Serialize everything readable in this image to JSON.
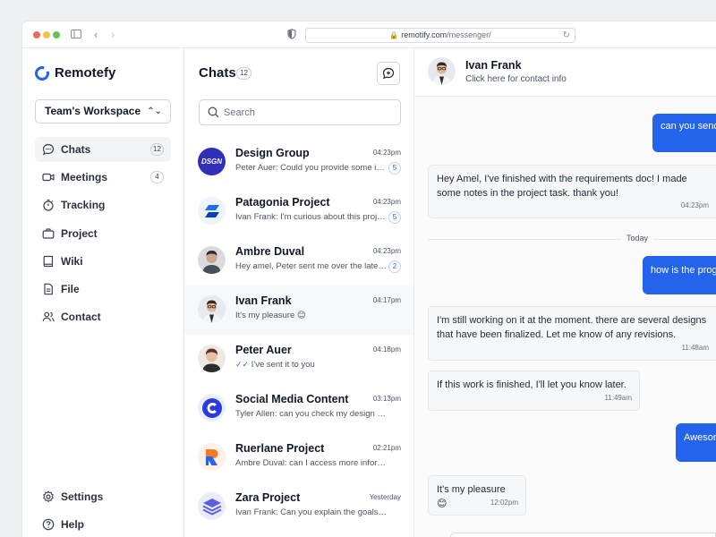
{
  "browser": {
    "url_host": "remotify.com",
    "url_path": "/messenger/"
  },
  "sidebar": {
    "brand": "Remotefy",
    "workspace": "Team's Workspace",
    "items": [
      {
        "label": "Chats",
        "icon": "chat-bubble-icon",
        "badge": "12",
        "active": true
      },
      {
        "label": "Meetings",
        "icon": "video-camera-icon",
        "badge": "4"
      },
      {
        "label": "Tracking",
        "icon": "stopwatch-icon"
      },
      {
        "label": "Project",
        "icon": "briefcase-icon"
      },
      {
        "label": "Wiki",
        "icon": "book-icon"
      },
      {
        "label": "File",
        "icon": "document-icon"
      },
      {
        "label": "Contact",
        "icon": "users-icon"
      }
    ],
    "bottom_items": [
      {
        "label": "Settings",
        "icon": "gear-icon"
      },
      {
        "label": "Help",
        "icon": "help-circle-icon"
      }
    ]
  },
  "chatlist": {
    "title": "Chats",
    "count": "12",
    "search_placeholder": "Search",
    "chats": [
      {
        "name": "Design Group",
        "time": "04:23pm",
        "preview": "Peter Auer: Could you provide some inputs on this?",
        "unread": "5",
        "avatar_text": "DSGN"
      },
      {
        "name": "Patagonia Project",
        "time": "04:23pm",
        "preview": "Ivan Frank: I'm curious about this project timeline",
        "unread": "5"
      },
      {
        "name": "Ambre Duval",
        "time": "04:23pm",
        "preview": "Hey amel, Peter sent me over the latest file",
        "unread": "2"
      },
      {
        "name": "Ivan Frank",
        "time": "04:17pm",
        "preview": "It's my pleasure 😊",
        "active": true
      },
      {
        "name": "Peter Auer",
        "time": "04:18pm",
        "preview": "I've sent it to you",
        "read_receipt": true
      },
      {
        "name": "Social Media Content",
        "time": "03:13pm",
        "preview": "Tyler Allen: can you check my design in the file?"
      },
      {
        "name": "Ruerlane Project",
        "time": "02:21pm",
        "preview": "Ambre Duval: can I access more information here?"
      },
      {
        "name": "Zara Project",
        "time": "Yesterday",
        "preview": "Ivan Frank: Can you explain the goals and scope?"
      }
    ]
  },
  "conversation": {
    "contact_name": "Ivan Frank",
    "contact_sub": "Click here for contact info",
    "day_divider": "Today",
    "messages": [
      {
        "dir": "out",
        "text": "can you send"
      },
      {
        "dir": "in",
        "text": "Hey Amel, I've finished with the requirements doc! I made some notes in the project task. thank you!",
        "time": "04:23pm"
      },
      {
        "dir": "out",
        "text": "how is the progress"
      },
      {
        "dir": "in",
        "text": "I'm still working on it at the moment. there are several designs that have been finalized. Let me know of any revisions.",
        "time": "11:48am"
      },
      {
        "dir": "in",
        "text": "If this work is finished, I'll let you know later.",
        "time": "11:49am"
      },
      {
        "dir": "out",
        "text": "Awesome! Th"
      },
      {
        "dir": "in",
        "text": "It's my pleasure 😊",
        "time": "12:02pm"
      }
    ]
  }
}
